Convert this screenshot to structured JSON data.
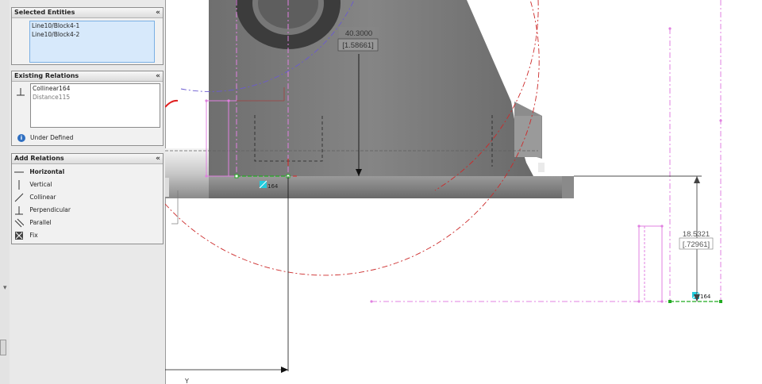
{
  "panel": {
    "selected_entities": {
      "title": "Selected Entities",
      "collapse_glyph": "«",
      "items": [
        "Line10/Block4-1",
        "Line10/Block4-2"
      ]
    },
    "existing_relations": {
      "title": "Existing Relations",
      "collapse_glyph": "«",
      "items": [
        "Collinear164",
        "Distance115"
      ],
      "status_icon": "info-icon",
      "status_icon_glyph": "i",
      "status_text": "Under Defined"
    },
    "add_relations": {
      "title": "Add Relations",
      "collapse_glyph": "«",
      "items": [
        {
          "label": "Horizontal",
          "icon": "horizontal-icon"
        },
        {
          "label": "Vertical",
          "icon": "vertical-icon"
        },
        {
          "label": "Collinear",
          "icon": "collinear-icon"
        },
        {
          "label": "Perpendicular",
          "icon": "perpendicular-icon"
        },
        {
          "label": "Parallel",
          "icon": "parallel-icon"
        },
        {
          "label": "Fix",
          "icon": "fix-icon"
        }
      ]
    },
    "side_arrow": "▾"
  },
  "viewport": {
    "dimension_1": {
      "value": "40.3000",
      "alt": "[1.58661]"
    },
    "dimension_2": {
      "value": "18.5321",
      "alt": "[.72961]"
    },
    "relation_tag_1": "164",
    "relation_tag_2": "164",
    "axis_label": "Y",
    "colors": {
      "sketch_magenta": "#e080e0",
      "construction_red": "#d03030",
      "arc_blue": "#6a5ad0",
      "part_gray": "#7a7a7a",
      "relation_green": "#22aa22",
      "relation_cyan": "#22ccdd"
    }
  }
}
